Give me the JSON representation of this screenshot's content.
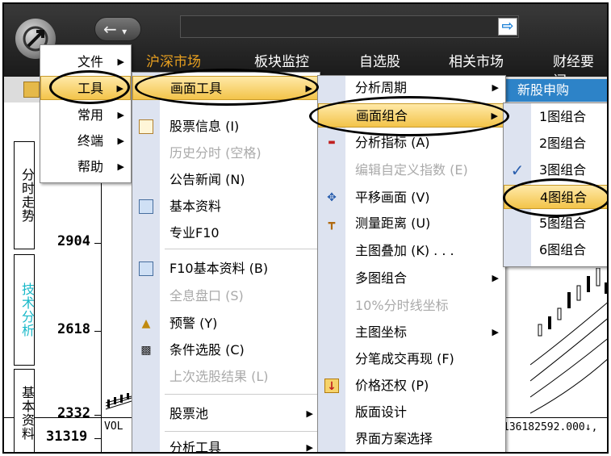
{
  "nav_tabs": [
    "沪深市场",
    "板块监控",
    "自选股",
    "相关市场",
    "财经要闻"
  ],
  "header": {
    "back_glyph": "←",
    "dropdown_glyph": "▾",
    "go_glyph": "⇨"
  },
  "subbar": {
    "new_stock": "新股申购"
  },
  "side_tabs": [
    "分时走势",
    "技术分析",
    "基本资料"
  ],
  "axis": {
    "y_ticks": [
      "2904",
      "2618",
      "2332"
    ],
    "vol_tick": "31319",
    "vol_label": "VOL",
    "vol_value": "136182592.000↓,"
  },
  "menu1": [
    {
      "label": "文件"
    },
    {
      "label": "工具"
    },
    {
      "label": "常用"
    },
    {
      "label": "终端"
    },
    {
      "label": "帮助"
    }
  ],
  "menu2": {
    "top": "画面工具",
    "items": [
      {
        "label": "股票信息 (I)",
        "icon": "info-icon"
      },
      {
        "label": "历史分时 (空格)",
        "disabled": true
      },
      {
        "label": "公告新闻 (N)"
      },
      {
        "label": "基本资料",
        "icon": "chart-icon"
      },
      {
        "label": "专业F10"
      },
      {
        "label": "F10基本资料 (B)",
        "icon": "chart-icon"
      },
      {
        "label": "全息盘口 (S)",
        "disabled": true
      },
      {
        "label": "预警 (Y)",
        "icon": "bell-icon"
      },
      {
        "label": "条件选股 (C)",
        "icon": "binoculars-icon"
      },
      {
        "label": "上次选股结果 (L)",
        "disabled": true
      },
      {
        "label": "股票池"
      },
      {
        "label": "分析工具"
      }
    ]
  },
  "menu3": [
    {
      "label": "分析周期"
    },
    {
      "label": "画面组合"
    },
    {
      "label": "分析指标 (A)",
      "icon": "indicator-icon"
    },
    {
      "label": "编辑自定义指数 (E)",
      "disabled": true
    },
    {
      "label": "平移画面 (V)",
      "icon": "move-icon"
    },
    {
      "label": "测量距离 (U)",
      "icon": "ruler-icon"
    },
    {
      "label": "主图叠加 (K) . . ."
    },
    {
      "label": "多图组合"
    },
    {
      "label": "10%分时线坐标",
      "disabled": true
    },
    {
      "label": "主图坐标"
    },
    {
      "label": "分笔成交再现 (F)"
    },
    {
      "label": "价格还权 (P)",
      "icon": "price-icon"
    },
    {
      "label": "版面设计"
    },
    {
      "label": "界面方案选择"
    }
  ],
  "menu4": [
    {
      "label": "1图组合"
    },
    {
      "label": "2图组合"
    },
    {
      "label": "3图组合",
      "checked": true
    },
    {
      "label": "4图组合"
    },
    {
      "label": "5图组合"
    },
    {
      "label": "6图组合"
    }
  ],
  "glyphs": {
    "submenu_arrow": "▶",
    "check": "✓"
  }
}
